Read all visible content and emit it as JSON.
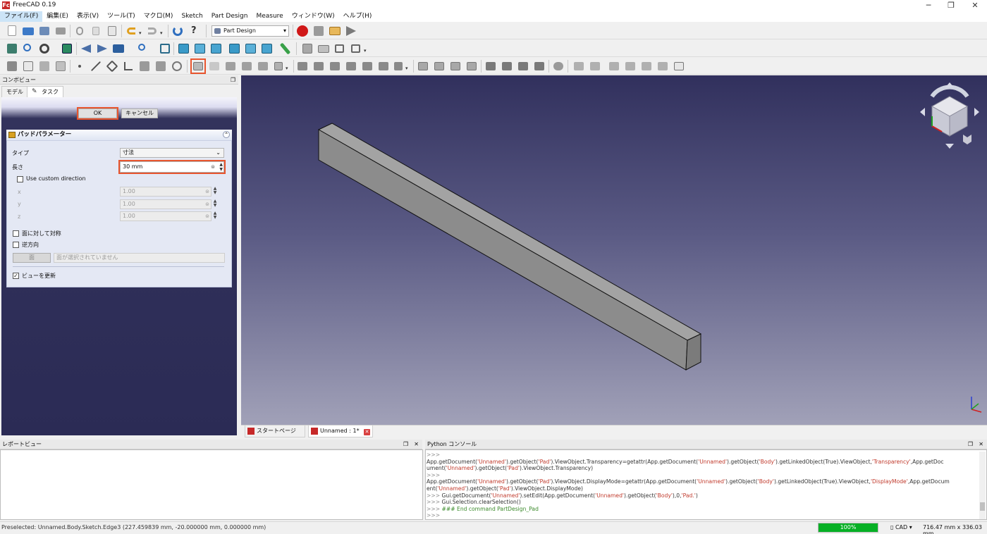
{
  "window": {
    "title": "FreeCAD 0.19",
    "logo": "Fc",
    "minimize_glyph": "─",
    "restore_glyph": "❐",
    "close_glyph": "✕"
  },
  "menu": [
    "ファイル(F)",
    "編集(E)",
    "表示(V)",
    "ツール(T)",
    "マクロ(M)",
    "Sketch",
    "Part Design",
    "Measure",
    "ウィンドウ(W)",
    "ヘルプ(H)"
  ],
  "toolbar": {
    "workbench": "Part Design"
  },
  "combo_view": {
    "title": "コンボビュー",
    "tabs": [
      "モデル",
      "タスク"
    ],
    "ok_label": "OK",
    "cancel_label": "キャンセル"
  },
  "pad": {
    "title": "パッドパラメーター",
    "type_label": "タイプ",
    "type_value": "寸法",
    "length_label": "長さ",
    "length_value": "30 mm",
    "custom_direction_label": "Use custom direction",
    "custom_direction_checked": false,
    "x_label": "x",
    "x_value": "1.00",
    "y_label": "y",
    "y_value": "1.00",
    "z_label": "z",
    "z_value": "1.00",
    "symmetric_label": "面に対して対称",
    "symmetric_checked": false,
    "reversed_label": "逆方向",
    "reversed_checked": false,
    "face_button": "面",
    "face_placeholder": "面が選択されていません",
    "update_view_label": "ビューを更新",
    "update_view_checked": true
  },
  "doc_tabs": [
    {
      "label": "スタートページ",
      "active": false
    },
    {
      "label": "Unnamed : 1*",
      "active": true
    }
  ],
  "report_view": {
    "title": "レポートビュー"
  },
  "python_console": {
    "title": "Python コンソール",
    "lines": [
      {
        "kind": "prompt",
        "parts": [
          [
            ">>>",
            "prompt"
          ]
        ]
      },
      {
        "kind": "code",
        "parts": [
          [
            "App.getDocument(",
            ""
          ],
          [
            "'Unnamed'",
            "str"
          ],
          [
            ").getObject(",
            ""
          ],
          [
            "'Pad'",
            "str"
          ],
          [
            ").ViewObject.Transparency=getattr(App.getDocument(",
            ""
          ],
          [
            "'Unnamed'",
            "str"
          ],
          [
            ").getObject(",
            ""
          ],
          [
            "'Body'",
            "str"
          ],
          [
            ").getLinkedObject(True).ViewObject,",
            ""
          ],
          [
            "'Transparency'",
            "str"
          ],
          [
            ",App.getDoc",
            ""
          ]
        ]
      },
      {
        "kind": "code",
        "parts": [
          [
            "ument(",
            ""
          ],
          [
            "'Unnamed'",
            "str"
          ],
          [
            ").getObject(",
            ""
          ],
          [
            "'Pad'",
            "str"
          ],
          [
            ").ViewObject.Transparency)",
            ""
          ]
        ]
      },
      {
        "kind": "prompt",
        "parts": [
          [
            ">>>",
            "prompt"
          ]
        ]
      },
      {
        "kind": "code",
        "parts": [
          [
            "App.getDocument(",
            ""
          ],
          [
            "'Unnamed'",
            "str"
          ],
          [
            ").getObject(",
            ""
          ],
          [
            "'Pad'",
            "str"
          ],
          [
            ").ViewObject.DisplayMode=getattr(App.getDocument(",
            ""
          ],
          [
            "'Unnamed'",
            "str"
          ],
          [
            ").getObject(",
            ""
          ],
          [
            "'Body'",
            "str"
          ],
          [
            ").getLinkedObject(True).ViewObject,",
            ""
          ],
          [
            "'DisplayMode'",
            "str"
          ],
          [
            ",App.getDocum",
            ""
          ]
        ]
      },
      {
        "kind": "code",
        "parts": [
          [
            "ent(",
            ""
          ],
          [
            "'Unnamed'",
            "str"
          ],
          [
            ").getObject(",
            ""
          ],
          [
            "'Pad'",
            "str"
          ],
          [
            ").ViewObject.DisplayMode)",
            ""
          ]
        ]
      },
      {
        "kind": "code",
        "parts": [
          [
            ">>> ",
            "prompt"
          ],
          [
            "Gui.getDocument(",
            ""
          ],
          [
            "'Unnamed'",
            "str"
          ],
          [
            ").setEdit(App.getDocument(",
            ""
          ],
          [
            "'Unnamed'",
            "str"
          ],
          [
            ").getObject(",
            ""
          ],
          [
            "'Body'",
            "str"
          ],
          [
            "),0,",
            ""
          ],
          [
            "'Pad.'",
            "str"
          ],
          [
            ")",
            ""
          ]
        ]
      },
      {
        "kind": "code",
        "parts": [
          [
            ">>> ",
            "prompt"
          ],
          [
            "Gui.Selection.clearSelection()",
            ""
          ]
        ]
      },
      {
        "kind": "code",
        "parts": [
          [
            ">>> ",
            "prompt"
          ],
          [
            "### End command PartDesign_Pad",
            "comment"
          ]
        ]
      },
      {
        "kind": "prompt",
        "parts": [
          [
            ">>>",
            "prompt"
          ]
        ]
      }
    ]
  },
  "status": {
    "message": "Preselected: Unnamed.Body.Sketch.Edge3 (227.459839 mm, -20.000000 mm, 0.000000 mm)",
    "progress": "100%",
    "nav_style": "CAD",
    "dimensions": "716.47 mm x 336.03 mm"
  },
  "colors": {
    "highlight": "#e8552e",
    "progress": "#06b025",
    "viewport_top": "#31305d",
    "viewport_bottom": "#a1a1b8",
    "solid": "#8c8c8c"
  }
}
